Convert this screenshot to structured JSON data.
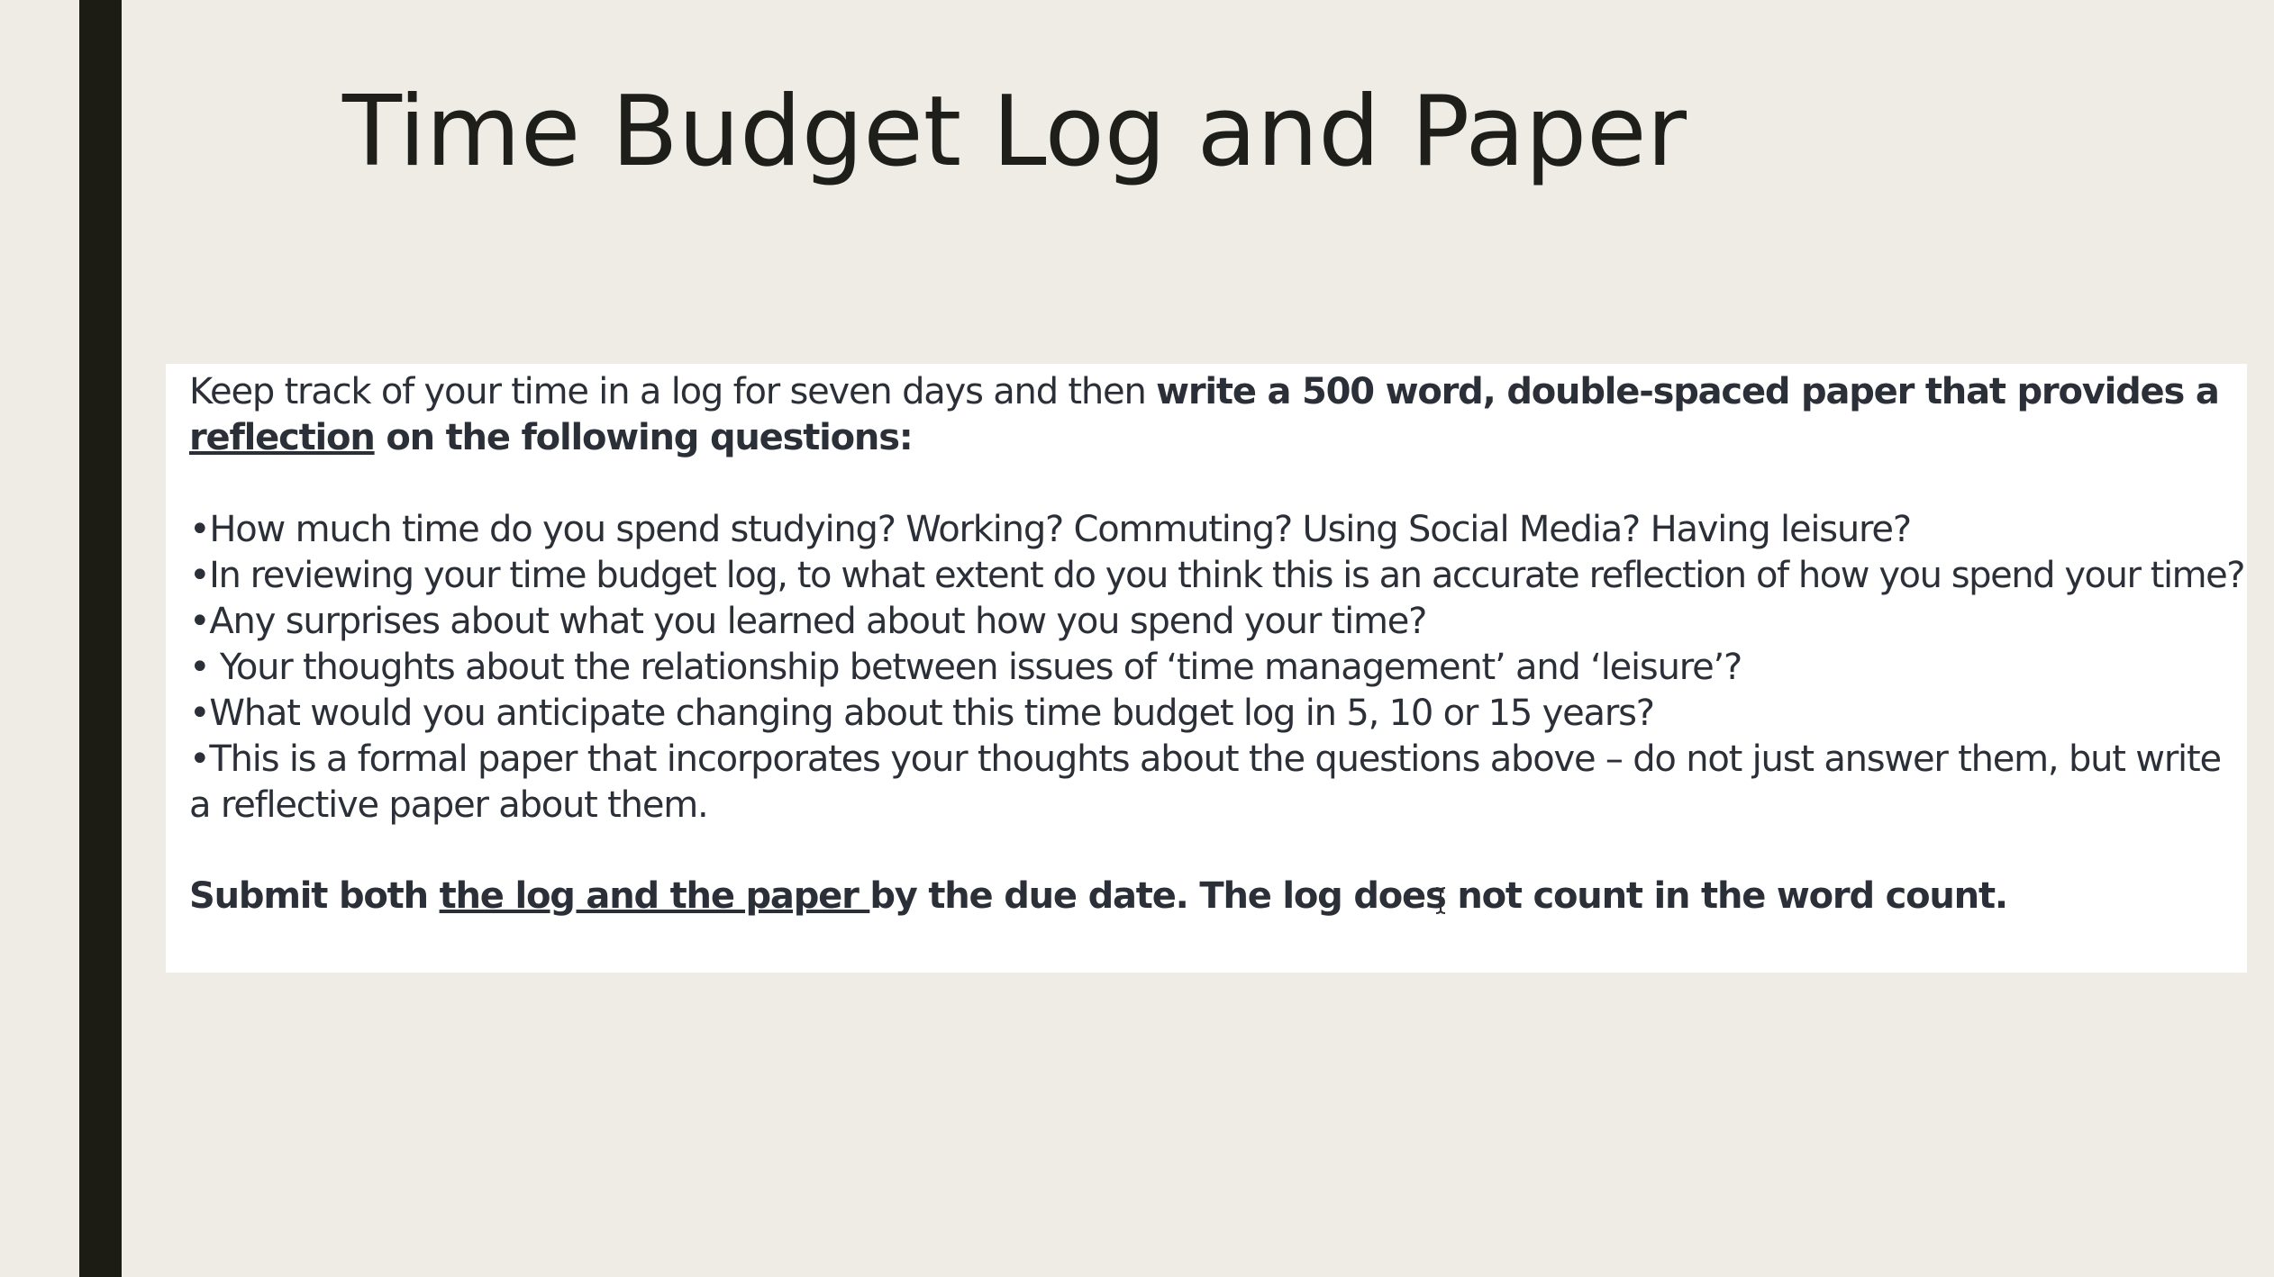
{
  "slide": {
    "title": "Time Budget Log and Paper",
    "intro": {
      "text_before": "Keep track of your time in a log for seven days and then ",
      "bold_part": "write a 500 word, double-spaced paper that provides a ",
      "bold_underlined": "reflection",
      "bold_after": " on the following questions:"
    },
    "bullets": [
      "•How much time do you spend studying? Working? Commuting? Using Social Media? Having leisure?",
      "•In reviewing your time budget log, to what extent do you think this is an accurate reflection of how you spend your time?",
      "•Any surprises about what you learned about how you spend your time?",
      "• Your thoughts about the relationship between issues of ‘time management’ and ‘leisure’?",
      "•What would you anticipate changing about this time budget log in 5, 10 or 15 years?",
      "•This is a formal paper that incorporates your thoughts about the questions above – do not just answer them, but write a reflective paper about them."
    ],
    "submit": {
      "before": "Submit both ",
      "underlined": "the log and the paper ",
      "after": "by the due date. The log does not count in the word count."
    }
  },
  "colors": {
    "background": "#efece5",
    "side_bar": "#1c1c14",
    "title_text": "#1e1e1a",
    "body_text": "#2b2f37",
    "content_box": "#ffffff"
  }
}
